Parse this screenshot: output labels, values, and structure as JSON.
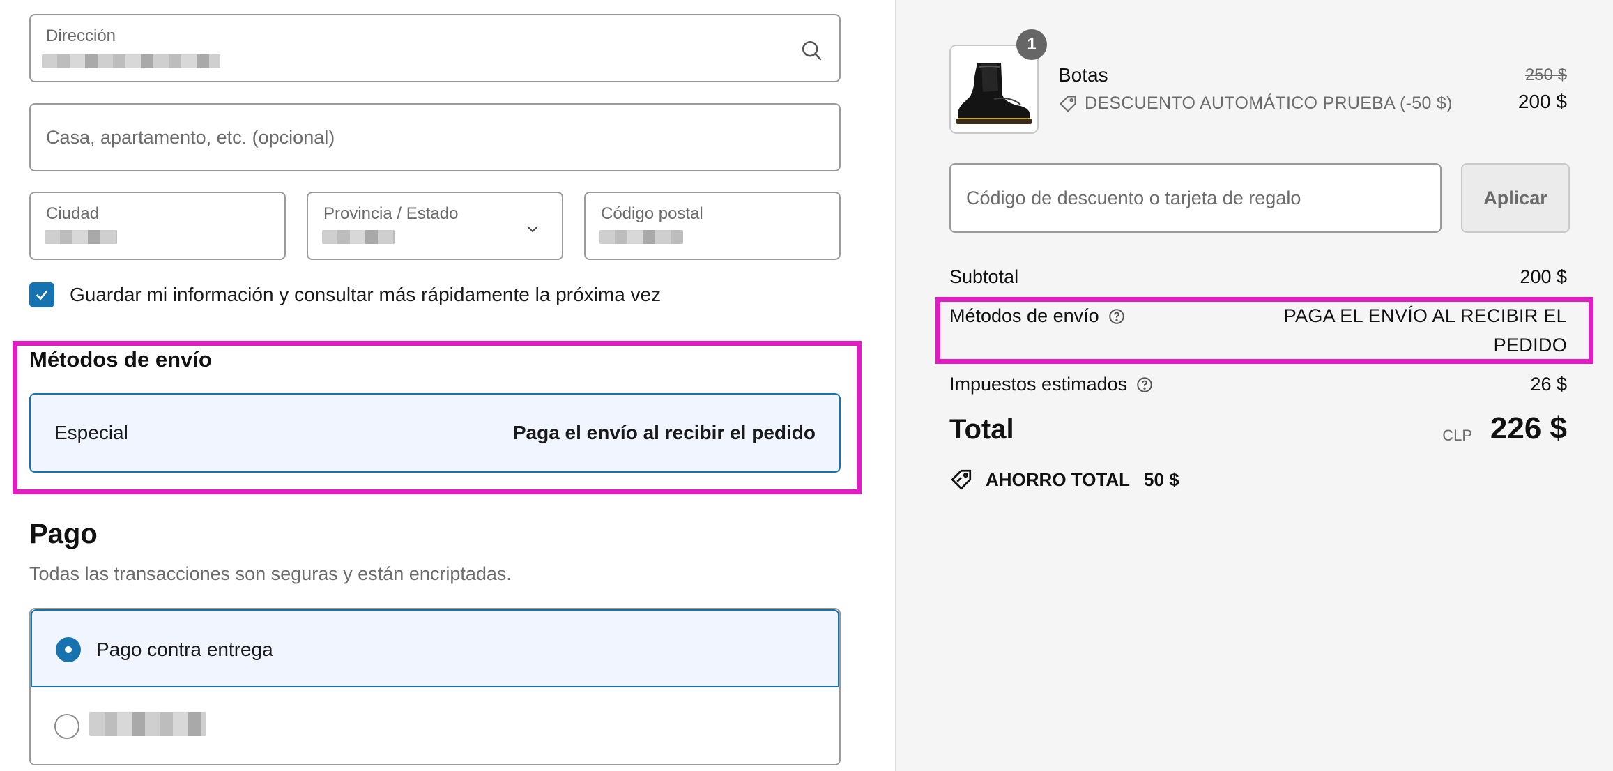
{
  "address": {
    "direccion_label": "Dirección",
    "apartment_placeholder": "Casa, apartamento, etc. (opcional)",
    "city_label": "Ciudad",
    "province_label": "Provincia / Estado",
    "postal_label": "Código postal",
    "save_info_label": "Guardar mi información y consultar más rápidamente la próxima vez",
    "save_info_checked": true
  },
  "shipping": {
    "title": "Métodos de envío",
    "method_name": "Especial",
    "method_price": "Paga el envío al recibir el pedido"
  },
  "payment": {
    "title": "Pago",
    "subtitle": "Todas las transacciones son seguras y están encriptadas.",
    "options": [
      {
        "label": "Pago contra entrega",
        "selected": true
      },
      {
        "label": "",
        "selected": false
      }
    ]
  },
  "summary": {
    "item": {
      "name": "Botas",
      "quantity": "1",
      "discount": "DESCUENTO AUTOMÁTICO PRUEBA (-50 $)",
      "original_price": "250 $",
      "price": "200 $"
    },
    "discount_input_placeholder": "Código de descuento o tarjeta de regalo",
    "apply_label": "Aplicar",
    "subtotal_label": "Subtotal",
    "subtotal_value": "200 $",
    "shipping_label": "Métodos de envío",
    "shipping_value": "PAGA EL ENVÍO AL RECIBIR EL PEDIDO",
    "taxes_label": "Impuestos estimados",
    "taxes_value": "26 $",
    "total_label": "Total",
    "currency": "CLP",
    "total_value": "226 $",
    "savings_label": "AHORRO TOTAL",
    "savings_value": "50 $"
  },
  "colors": {
    "accent": "#1773b0",
    "highlight": "#e01cc2",
    "selected_bg": "#f0f5ff",
    "sidebar_bg": "#f5f5f5"
  }
}
